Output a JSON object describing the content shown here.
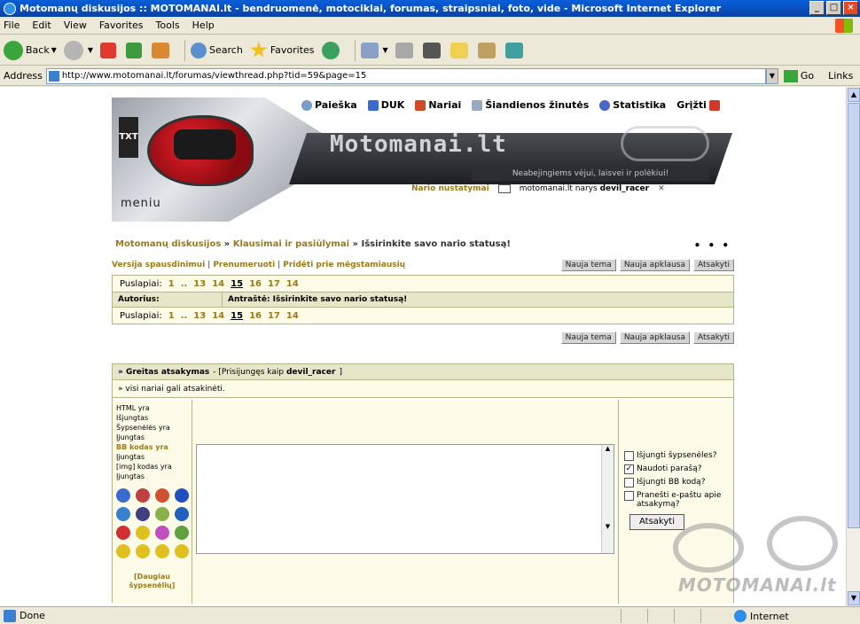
{
  "window": {
    "title": "Motomanų diskusijos :: MOTOMANAI.lt - bendruomenė, motociklai, forumas, straipsniai, foto, vide - Microsoft Internet Explorer"
  },
  "menu": [
    "File",
    "Edit",
    "View",
    "Favorites",
    "Tools",
    "Help"
  ],
  "toolbar": {
    "back": "Back",
    "search": "Search",
    "favorites": "Favorites"
  },
  "address": {
    "label": "Address",
    "url": "http://www.motomanai.lt/forumas/viewthread.php?tid=59&page=15",
    "go": "Go",
    "links": "Links"
  },
  "header": {
    "nav": [
      "Paieška",
      "DUK",
      "Nariai",
      "Šiandienos žinutės",
      "Statistika",
      "Grįžti"
    ],
    "logo": "Motomanai.lt",
    "slogan": "Neabejingiems vėjui, laisvei ir polėkiui!",
    "menu_word": "meniu",
    "tag": "TXT",
    "member_settings": "Nario nustatymai",
    "user_prefix": "motomanai.lt narys",
    "username": "devil_racer"
  },
  "breadcrumb": {
    "forum": "Motomanų diskusijos",
    "sep1": " » ",
    "section": "Klausimai ir pasiūlymai",
    "sep2": " » ",
    "topic": "Išsirinkite savo nario statusą!",
    "dots": "• • •"
  },
  "actions": {
    "print": "Versija spausdinimui",
    "subscribe": "Prenumeruoti",
    "add_fav": "Pridėti prie mėgstamiausių",
    "new_topic": "Nauja tema",
    "new_poll": "Nauja apklausa",
    "reply": "Atsakyti"
  },
  "pagination": {
    "label": "Puslapiai:",
    "pages": [
      "1",
      "..",
      "13",
      "14",
      "15",
      "16",
      "17",
      "14"
    ],
    "current": "15"
  },
  "thread_table": {
    "author_col": "Autorius:",
    "topic_col": "Antraštė: Išsirinkite savo nario statusą!"
  },
  "quick_reply": {
    "title": "» Greitas atsakymas",
    "logged_as_prefix": "- [Prisijungęs kaip",
    "logged_user": "devil_racer",
    "logged_as_suffix": "]",
    "notice": "» visi nariai gali atsakinėti.",
    "info_lines": [
      "HTML yra",
      "Išjungtas",
      "Šypsenėlės yra",
      "Įjungtas",
      "BB kodas yra",
      "Įjungtas",
      "[img] kodas yra",
      "Įjungtas"
    ],
    "more_smileys": "[Daugiau šypsenėlių]",
    "options": [
      {
        "label": "Išjungti šypsenėles?",
        "checked": false
      },
      {
        "label": "Naudoti parašą?",
        "checked": true
      },
      {
        "label": "Išjungti BB kodą?",
        "checked": false
      },
      {
        "label": "Pranešti e-paštu apie atsakymą?",
        "checked": false
      }
    ],
    "submit": "Atsakyti"
  },
  "watermark": "MOTOMANAI.lt",
  "status": {
    "text": "Done",
    "zone": "Internet"
  },
  "colors": {
    "link_gold": "#9a7a1a",
    "table_bg": "#fbfbe8",
    "table_head": "#e6e6c8",
    "xp_blue": "#0a5fd8"
  }
}
